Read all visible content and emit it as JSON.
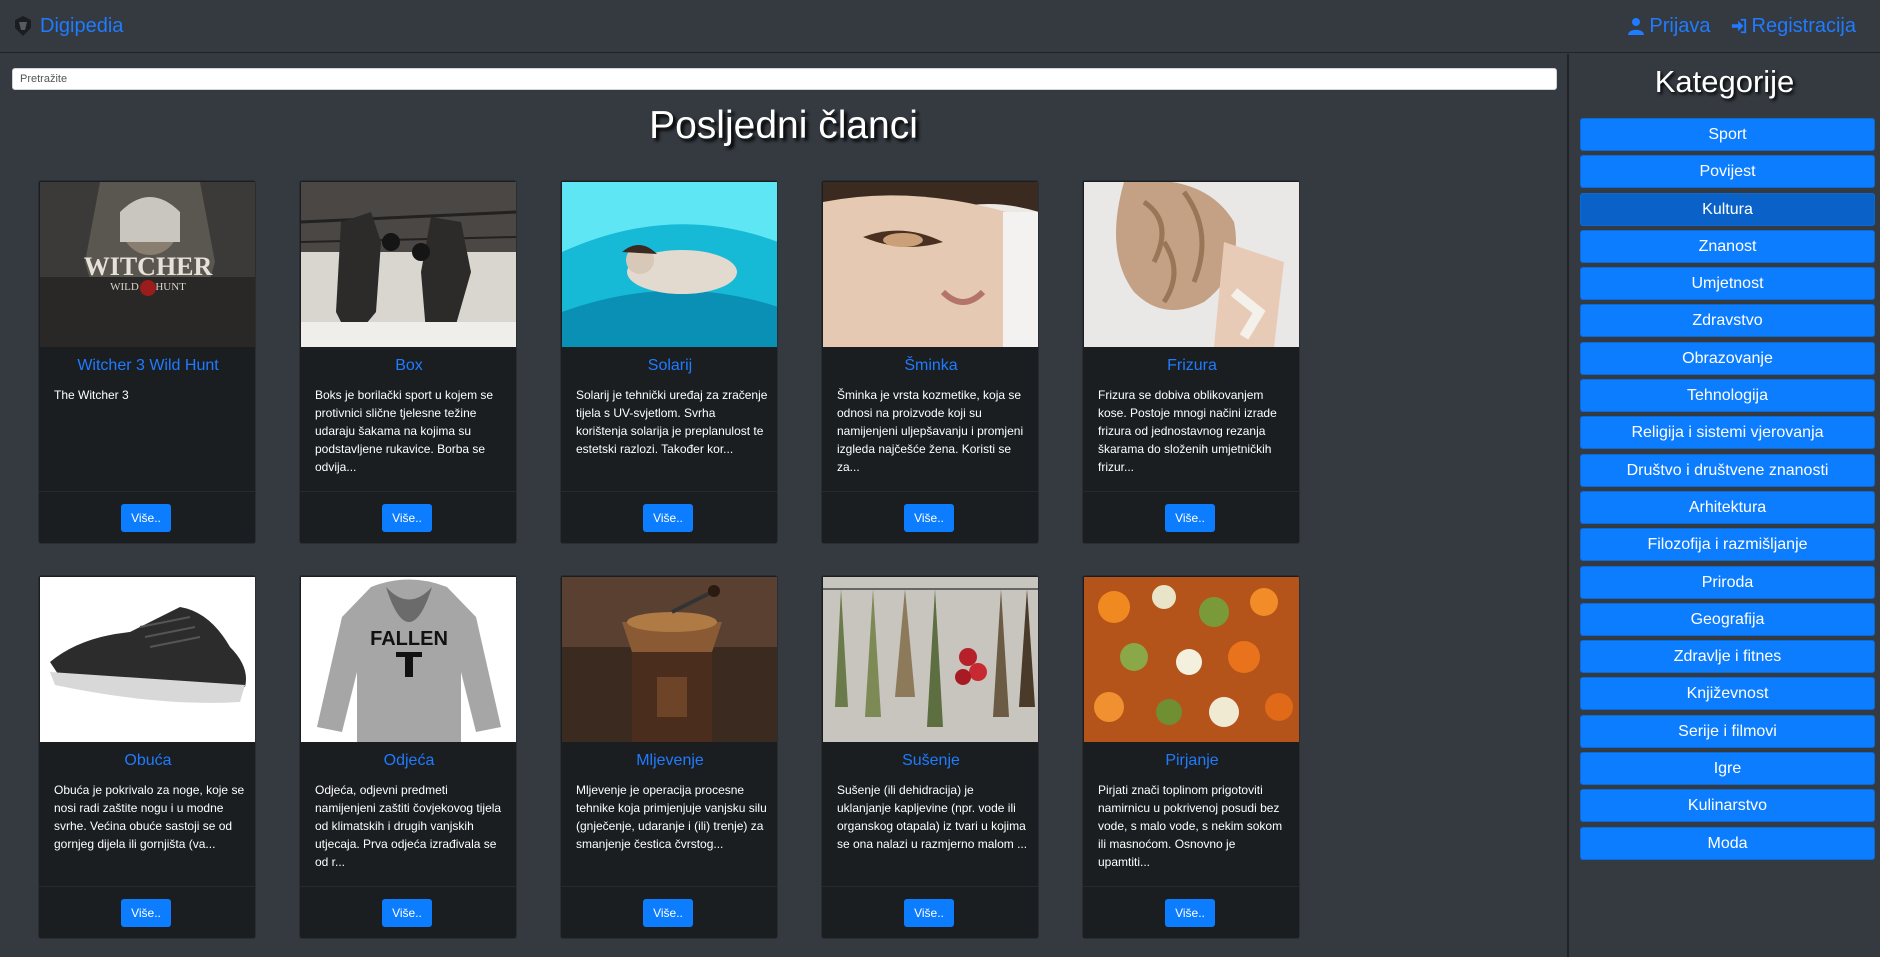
{
  "navbar": {
    "brand": "Digipedia",
    "login": "Prijava",
    "register": "Registracija"
  },
  "search": {
    "placeholder": "Pretražite"
  },
  "main": {
    "heading": "Posljedni članci"
  },
  "articles": [
    {
      "title": "Witcher 3 Wild Hunt",
      "text": "The Witcher 3",
      "button": "Više..",
      "image": "witcher-cover"
    },
    {
      "title": "Box",
      "text": "Boks je borilački sport u kojem se protivnici slične tjelesne težine udaraju šakama na kojima su podstavljene rukavice. Borba se odvija...",
      "button": "Više..",
      "image": "boxing-photo"
    },
    {
      "title": "Solarij",
      "text": "Solarij je tehnički uređaj za zračenje tijela s UV-svjetlom. Svrha korištenja solarija je preplanulost te estetski razlozi. Također kor...",
      "button": "Više..",
      "image": "solarium-photo"
    },
    {
      "title": "Šminka",
      "text": "Šminka je vrsta kozmetike, koja se odnosi na proizvode koji su namijenjeni uljepšavanju i promjeni izgleda najčešće žena. Koristi se za...",
      "button": "Više..",
      "image": "makeup-photo"
    },
    {
      "title": "Frizura",
      "text": "Frizura se dobiva oblikovanjem kose. Postoje mnogi načini izrade frizura od jednostavnog rezanja škarama do složenih umjetničkih frizur...",
      "button": "Više..",
      "image": "hairstyle-photo"
    },
    {
      "title": "Obuća",
      "text": "Obuća je pokrivalo za noge, koje se nosi radi zaštite nogu i u modne svrhe. Većina obuće sastoji se od gornjeg dijela ili gornjišta (va...",
      "button": "Više..",
      "image": "shoe-photo"
    },
    {
      "title": "Odjeća",
      "text": "Odjeća, odjevni predmeti namijenjeni zaštiti čovjekovog tijela od klimatskih i drugih vanjskih utjecaja. Prva odjeća izrađivala se od r...",
      "button": "Više..",
      "image": "hoodie-photo"
    },
    {
      "title": "Mljevenje",
      "text": "Mljevenje je operacija procesne tehnike koja primjenjuje vanjsku silu (gnječenje, udaranje i (ili) trenje) za smanjenje čestica čvrstog...",
      "button": "Više..",
      "image": "grinder-photo"
    },
    {
      "title": "Sušenje",
      "text": "Sušenje (ili dehidracija) je uklanjanje kapljevine (npr. vode ili organskog otapala) iz tvari u kojima se ona nalazi u razmjerno malom ...",
      "button": "Više..",
      "image": "drying-herbs-photo"
    },
    {
      "title": "Pirjanje",
      "text": "Pirjati znači toplinom prigotoviti namirnicu u pokrivenoj posudi bez vode, s malo vode, s nekim sokom ili masnoćom. Osnovno je upamtiti...",
      "button": "Više..",
      "image": "vegetables-photo"
    }
  ],
  "sidebar": {
    "title": "Kategorije",
    "categories": [
      "Sport",
      "Povijest",
      "Kultura",
      "Znanost",
      "Umjetnost",
      "Zdravstvo",
      "Obrazovanje",
      "Tehnologija",
      "Religija i sistemi vjerovanja",
      "Društvo i društvene znanosti",
      "Arhitektura",
      "Filozofija i razmišljanje",
      "Priroda",
      "Geografija",
      "Zdravlje i fitnes",
      "Književnost",
      "Serije i filmovi",
      "Igre",
      "Kulinarstvo",
      "Moda"
    ],
    "active_index": 2
  },
  "colors": {
    "accent": "#0d7dff",
    "link": "#1f7bff",
    "background": "#343a40",
    "card": "#1b1e21"
  }
}
